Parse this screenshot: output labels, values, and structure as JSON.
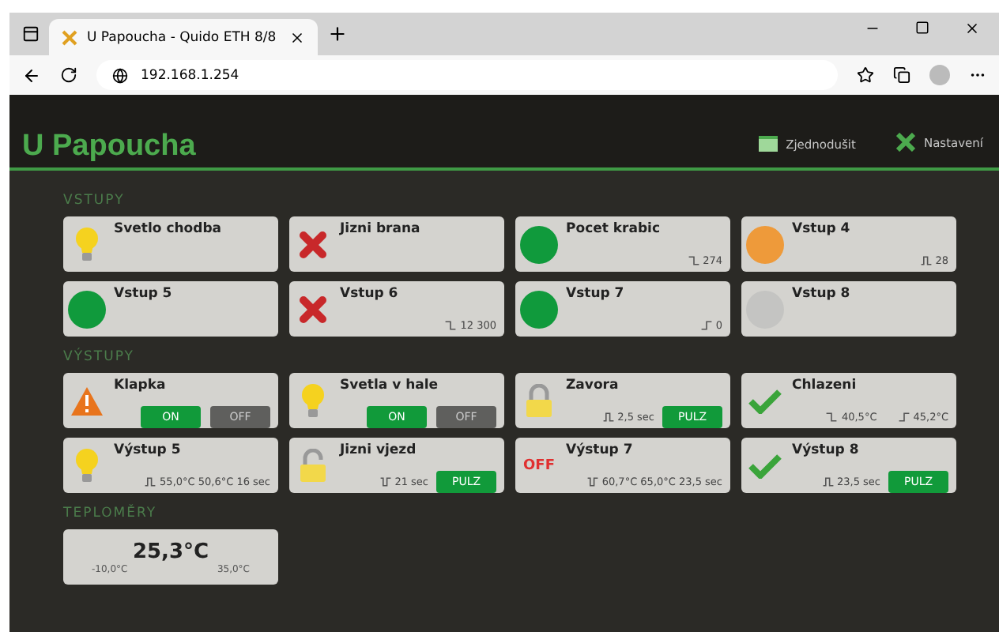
{
  "browser": {
    "tab_title": "U Papoucha - Quido ETH 8/8",
    "url": "192.168.1.254"
  },
  "header": {
    "title": "U Papoucha",
    "links": [
      {
        "label": "Zjednodušit",
        "kind": "simple"
      },
      {
        "label": "Nastavení",
        "kind": "settings"
      }
    ]
  },
  "inputs": {
    "heading": "VSTUPY",
    "items": [
      {
        "name": "Svetlo chodba",
        "kind": "bulb"
      },
      {
        "name": "Jizni brana",
        "kind": "cross"
      },
      {
        "name": "Pocet krabic",
        "kind": "dot",
        "color": "#109a3c",
        "counter": {
          "kind": "falling",
          "value": "274"
        }
      },
      {
        "name": "Vstup 4",
        "kind": "dot",
        "color": "#ee9a3a",
        "counter": {
          "kind": "pulse",
          "value": "28"
        }
      },
      {
        "name": "Vstup 5",
        "kind": "dot",
        "color": "#109a3c"
      },
      {
        "name": "Vstup 6",
        "kind": "cross",
        "counter": {
          "kind": "falling",
          "value": "12 300"
        }
      },
      {
        "name": "Vstup 7",
        "kind": "dot",
        "color": "#109a3c",
        "counter": {
          "kind": "rising",
          "value": "0"
        }
      },
      {
        "name": "Vstup 8",
        "kind": "dot",
        "color": "#c4c4c2"
      }
    ]
  },
  "outputs": {
    "heading": "VÝSTUPY",
    "items": [
      {
        "name": "Klapka",
        "kind": "warning",
        "switch": [
          {
            "label": "ON",
            "selected": true
          },
          {
            "label": "OFF",
            "selected": false
          }
        ]
      },
      {
        "name": "Svetla v hale",
        "kind": "bulb",
        "switch": [
          {
            "label": "ON",
            "selected": true
          },
          {
            "label": "OFF",
            "selected": false
          }
        ]
      },
      {
        "name": "Zavora",
        "kind": "lock",
        "info": [
          {
            "kind": "pulse",
            "text": "2,5 sec"
          }
        ],
        "pulse_button": "PULZ"
      },
      {
        "name": "Chlazeni",
        "kind": "check",
        "info": [
          {
            "kind": "falling",
            "text": "40,5°C"
          },
          {
            "kind": "rising",
            "text": "45,2°C"
          }
        ]
      },
      {
        "name": "Výstup 5",
        "kind": "bulb",
        "info": [
          {
            "kind": "pulse",
            "text": "55,0°C 50,6°C 16 sec"
          }
        ]
      },
      {
        "name": "Jizni vjezd",
        "kind": "unlock",
        "info": [
          {
            "kind": "negpulse",
            "text": "21 sec"
          }
        ],
        "pulse_button": "PULZ"
      },
      {
        "name": "Výstup 7",
        "kind": "text",
        "icon_text": "OFF",
        "info": [
          {
            "kind": "negpulse",
            "text": "60,7°C 65,0°C 23,5 sec"
          }
        ]
      },
      {
        "name": "Výstup 8",
        "kind": "check",
        "info": [
          {
            "kind": "pulse",
            "text": "23,5 sec"
          }
        ],
        "pulse_button": "PULZ"
      }
    ]
  },
  "thermometers": {
    "heading": "TEPLOMĚRY",
    "items": [
      {
        "value": "25,3°C",
        "min": "-10,0°C",
        "max": "35,0°C"
      }
    ]
  }
}
